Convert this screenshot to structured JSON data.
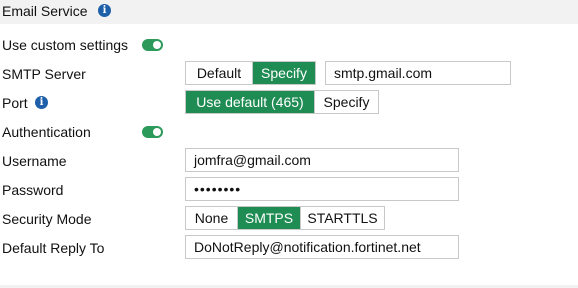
{
  "header": {
    "title": "Email Service",
    "info_icon": "info-icon"
  },
  "custom_settings": {
    "label": "Use custom settings",
    "enabled": true
  },
  "smtp_server": {
    "label": "SMTP Server",
    "options": [
      "Default",
      "Specify"
    ],
    "selected": "Specify",
    "value": "smtp.gmail.com"
  },
  "port": {
    "label": "Port",
    "info_icon": "info-icon",
    "options": [
      "Use default (465)",
      "Specify"
    ],
    "selected": "Use default (465)"
  },
  "authentication": {
    "label": "Authentication",
    "enabled": true
  },
  "username": {
    "label": "Username",
    "value": "jomfra@gmail.com"
  },
  "password": {
    "label": "Password",
    "value": "••••••••"
  },
  "security_mode": {
    "label": "Security Mode",
    "options": [
      "None",
      "SMTPS",
      "STARTTLS"
    ],
    "selected": "SMTPS"
  },
  "reply_to": {
    "label": "Default Reply To",
    "value": "DoNotReply@notification.fortinet.net"
  },
  "colors": {
    "accent": "#1f8c53",
    "toggle_on": "#2c9a5a",
    "info": "#1d5fa8",
    "header_bg": "#f2f2f2"
  }
}
